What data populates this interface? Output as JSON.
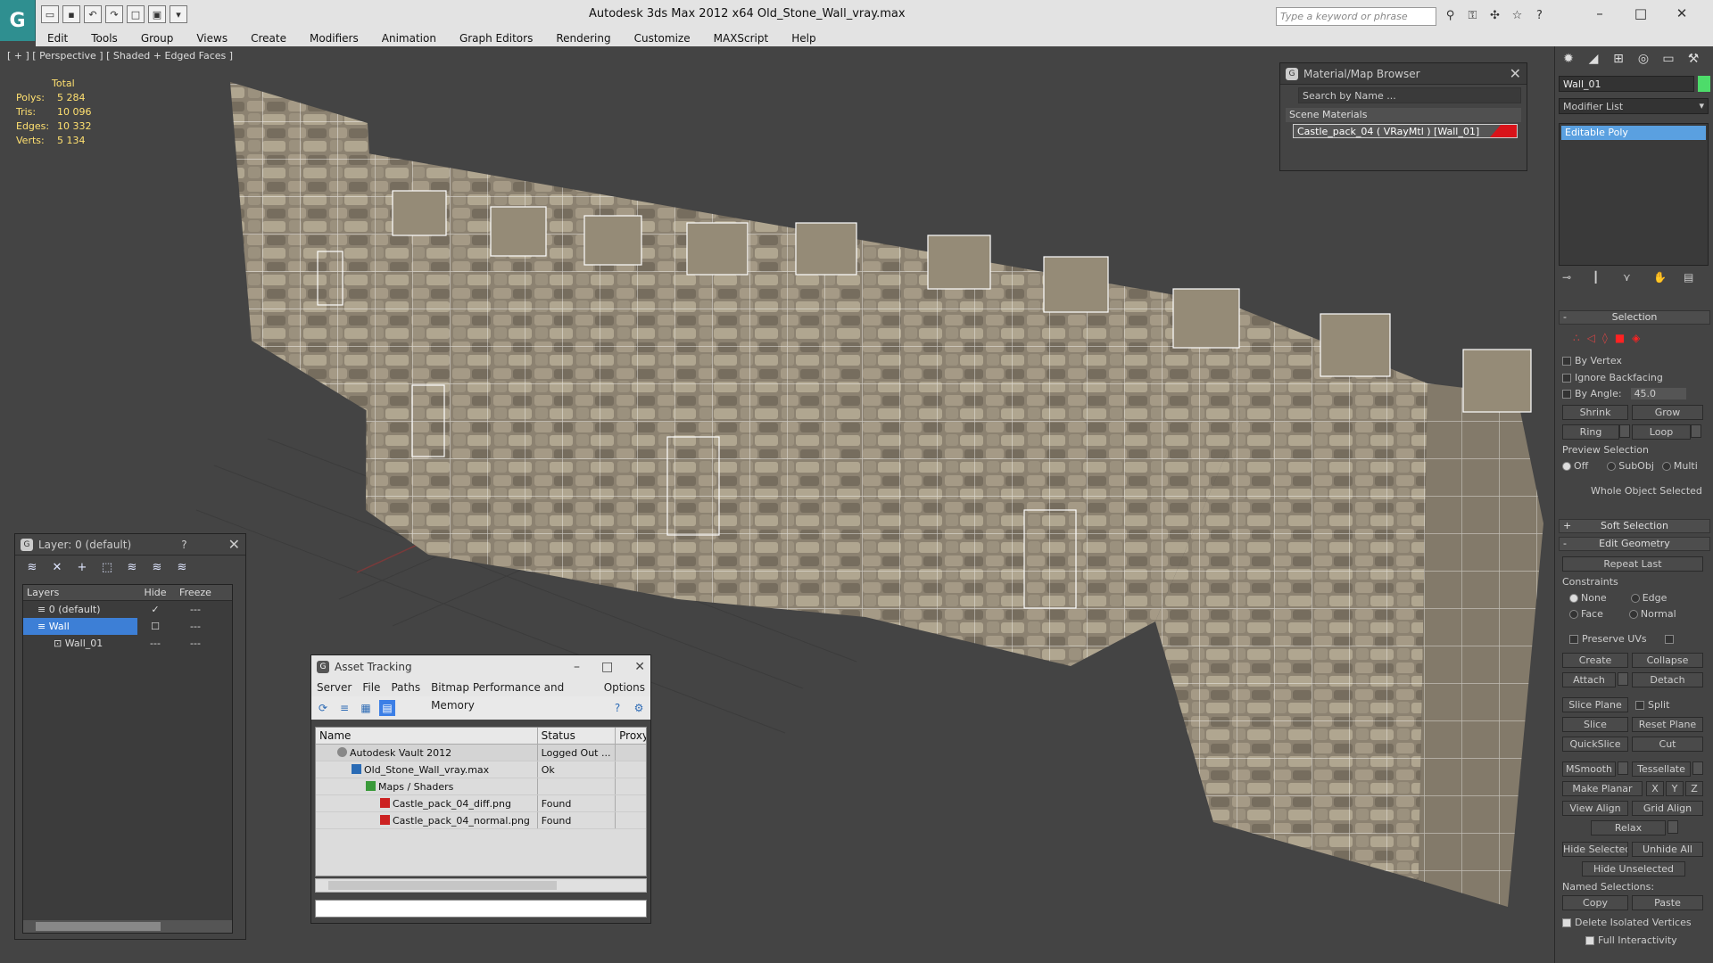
{
  "title_bar": {
    "app_title": "Autodesk 3ds Max  2012 x64      Old_Stone_Wall_vray.max",
    "search_placeholder": "Type a keyword or phrase"
  },
  "menu": [
    "Edit",
    "Tools",
    "Group",
    "Views",
    "Create",
    "Modifiers",
    "Animation",
    "Graph Editors",
    "Rendering",
    "Customize",
    "MAXScript",
    "Help"
  ],
  "viewport": {
    "label": "[ + ] [ Perspective ] [ Shaded + Edged Faces ]",
    "stats": {
      "header": "Total",
      "rows": [
        {
          "k": "Polys:",
          "v": "5 284"
        },
        {
          "k": "Tris:",
          "v": "10 096"
        },
        {
          "k": "Edges:",
          "v": "10 332"
        },
        {
          "k": "Verts:",
          "v": "5 134"
        }
      ]
    }
  },
  "material_browser": {
    "title": "Material/Map Browser",
    "search": "Search by Name ...",
    "section": "Scene Materials",
    "item": "Castle_pack_04  ( VRayMtl ) [Wall_01]",
    "swatch_color": "#d9131a"
  },
  "layer_window": {
    "title": "Layer: 0 (default)",
    "help": "?",
    "headers": {
      "layers": "Layers",
      "hide": "Hide",
      "freeze": "Freeze"
    },
    "rows": [
      {
        "name": "0 (default)",
        "hide": "✓",
        "freeze": "---"
      },
      {
        "name": "Wall",
        "hide": "☐",
        "freeze": "---"
      },
      {
        "name": "Wall_01",
        "hide": "---",
        "freeze": "---"
      }
    ]
  },
  "asset_tracking": {
    "title": "Asset Tracking",
    "menu": [
      "Server",
      "File",
      "Paths",
      "Bitmap Performance and Memory",
      "Options"
    ],
    "headers": {
      "name": "Name",
      "status": "Status",
      "proxy": "Proxy"
    },
    "rows": [
      {
        "name": "Autodesk Vault 2012",
        "status": "Logged Out ..."
      },
      {
        "name": "Old_Stone_Wall_vray.max",
        "status": "Ok"
      },
      {
        "name": "Maps / Shaders",
        "status": ""
      },
      {
        "name": "Castle_pack_04_diff.png",
        "status": "Found"
      },
      {
        "name": "Castle_pack_04_normal.png",
        "status": "Found"
      }
    ]
  },
  "command_panel": {
    "object_name": "Wall_01",
    "modifier_list": "Modifier List",
    "stack_item": "Editable Poly",
    "object_color": "#4ddc6a",
    "selection": {
      "title": "Selection",
      "by_vertex": "By Vertex",
      "ignore_backfacing": "Ignore Backfacing",
      "by_angle": "By Angle:",
      "angle": "45.0",
      "shrink": "Shrink",
      "grow": "Grow",
      "ring": "Ring",
      "loop": "Loop",
      "preview": "Preview Selection",
      "off": "Off",
      "subobj": "SubObj",
      "multi": "Multi",
      "status": "Whole Object Selected"
    },
    "soft_selection": "Soft Selection",
    "edit_geometry": {
      "title": "Edit Geometry",
      "repeat_last": "Repeat Last",
      "constraints": "Constraints",
      "none": "None",
      "edge": "Edge",
      "face": "Face",
      "normal": "Normal",
      "preserve_uvs": "Preserve UVs",
      "create": "Create",
      "collapse": "Collapse",
      "attach": "Attach",
      "detach": "Detach",
      "slice_plane": "Slice Plane",
      "split": "Split",
      "slice": "Slice",
      "reset_plane": "Reset Plane",
      "quickslice": "QuickSlice",
      "cut": "Cut",
      "msmooth": "MSmooth",
      "tessellate": "Tessellate",
      "make_planar": "Make Planar",
      "x": "X",
      "y": "Y",
      "z": "Z",
      "view_align": "View Align",
      "grid_align": "Grid Align",
      "relax": "Relax",
      "hide_selected": "Hide Selected",
      "unhide_all": "Unhide All",
      "hide_unselected": "Hide Unselected",
      "named_selections": "Named Selections:",
      "copy": "Copy",
      "paste": "Paste",
      "delete_isolated": "Delete Isolated Vertices",
      "full_interactivity": "Full Interactivity"
    }
  }
}
